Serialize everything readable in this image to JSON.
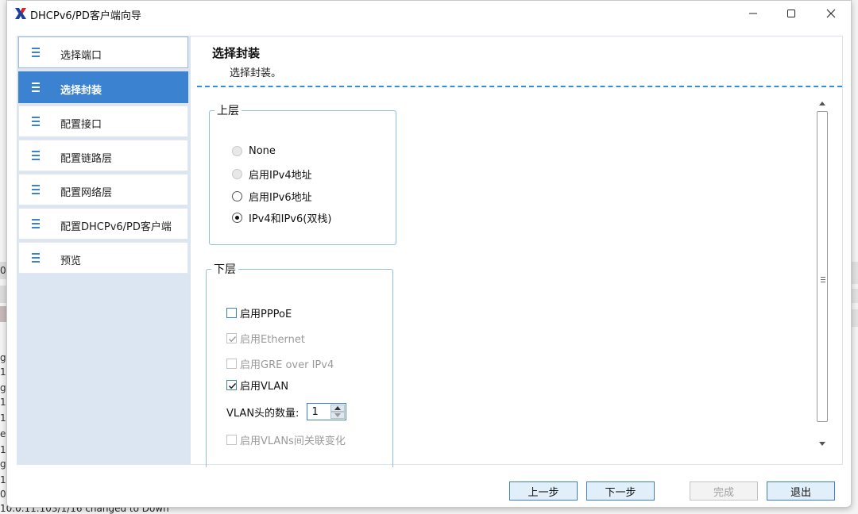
{
  "window": {
    "title": "DHCPv6/PD客户端向导",
    "app_icon": "x-logo-icon",
    "controls": [
      "minimize-icon",
      "maximize-icon",
      "close-icon"
    ]
  },
  "sidebar": {
    "items": [
      {
        "label": "选择端口",
        "icon": "list-icon",
        "active": false
      },
      {
        "label": "选择封装",
        "icon": "list-icon",
        "active": true
      },
      {
        "label": "配置接口",
        "icon": "list-icon",
        "active": false
      },
      {
        "label": "配置链路层",
        "icon": "list-icon",
        "active": false
      },
      {
        "label": "配置网络层",
        "icon": "list-icon",
        "active": false
      },
      {
        "label": "配置DHCPv6/PD客户端",
        "icon": "list-icon",
        "active": false
      },
      {
        "label": "预览",
        "icon": "list-icon",
        "active": false
      }
    ]
  },
  "content": {
    "heading": "选择封装",
    "subheading": "选择封装。",
    "upper": {
      "title": "上层",
      "options": [
        {
          "label": "None",
          "checked": false,
          "disabled": true
        },
        {
          "label": "启用IPv4地址",
          "checked": false,
          "disabled": true
        },
        {
          "label": "启用IPv6地址",
          "checked": false,
          "disabled": false
        },
        {
          "label": "IPv4和IPv6(双栈)",
          "checked": true,
          "disabled": false
        }
      ]
    },
    "lower": {
      "title": "下层",
      "options": [
        {
          "label": "启用PPPoE",
          "checked": false,
          "disabled": false
        },
        {
          "label": "启用Ethernet",
          "checked": true,
          "disabled": true
        },
        {
          "label": "启用GRE over IPv4",
          "checked": false,
          "disabled": true
        },
        {
          "label": "启用VLAN",
          "checked": true,
          "disabled": false
        }
      ],
      "vlan_count_label": "VLAN头的数量:",
      "vlan_count_value": "1",
      "vlan_change": {
        "label": "启用VLANs间关联变化",
        "checked": false,
        "disabled": true
      }
    }
  },
  "footer": {
    "prev": "上一步",
    "next": "下一步",
    "finish": "完成",
    "exit": "退出"
  },
  "background": {
    "status_line": "10.0.11.103/1/16 changed to Down",
    "edge_chars": [
      "0",
      "g",
      "1",
      "g",
      "1",
      "1",
      "e",
      "1",
      "g",
      "1",
      "0"
    ]
  },
  "colors": {
    "accent": "#3b82d0",
    "sidebar_bg": "#dbe6f2",
    "dash": "#2f8fd8",
    "button_bg": "#e1effa",
    "button_border": "#3c7fc4"
  }
}
